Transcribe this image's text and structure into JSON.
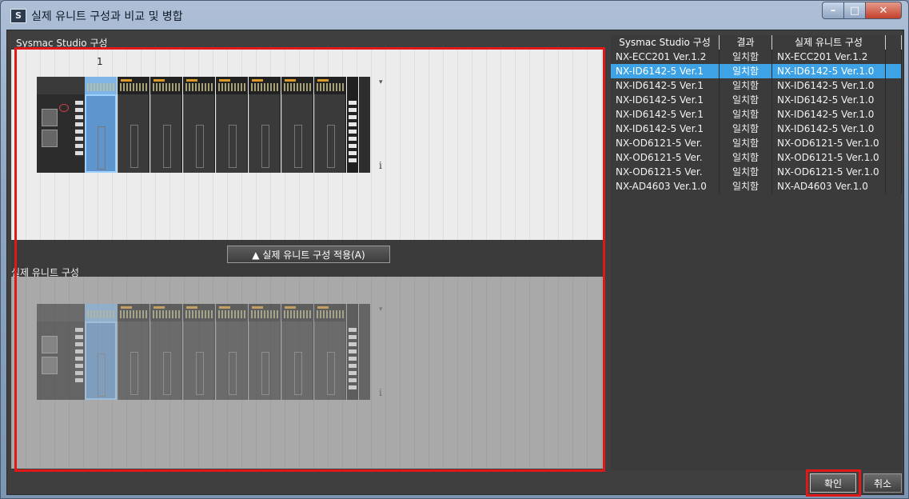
{
  "window": {
    "title": "실제 유니트 구성과 비교 및 병합",
    "app_icon": "S",
    "icons": [
      "app-icon",
      "minimize-icon",
      "maximize-icon",
      "close-icon"
    ]
  },
  "top_section": {
    "label": "Sysmac Studio 구성",
    "unit_number": "1"
  },
  "apply_button": {
    "label": "▲ 실제 유니트 구성 적용(A)"
  },
  "bottom_section": {
    "label": "실제 유니트 구성"
  },
  "rack": {
    "arrow": "▾",
    "info": "i"
  },
  "table": {
    "columns": [
      "Sysmac Studio 구성",
      "결과",
      "실제 유니트 구성"
    ],
    "rows": [
      [
        "NX-ECC201 Ver.1.2",
        "일치함",
        "NX-ECC201 Ver.1.2"
      ],
      [
        "NX-ID6142-5 Ver.1",
        "일치함",
        "NX-ID6142-5 Ver.1.0"
      ],
      [
        "NX-ID6142-5 Ver.1",
        "일치함",
        "NX-ID6142-5 Ver.1.0"
      ],
      [
        "NX-ID6142-5 Ver.1",
        "일치함",
        "NX-ID6142-5 Ver.1.0"
      ],
      [
        "NX-ID6142-5 Ver.1",
        "일치함",
        "NX-ID6142-5 Ver.1.0"
      ],
      [
        "NX-ID6142-5 Ver.1",
        "일치함",
        "NX-ID6142-5 Ver.1.0"
      ],
      [
        "NX-OD6121-5 Ver.",
        "일치함",
        "NX-OD6121-5 Ver.1.0"
      ],
      [
        "NX-OD6121-5 Ver.",
        "일치함",
        "NX-OD6121-5 Ver.1.0"
      ],
      [
        "NX-OD6121-5 Ver.",
        "일치함",
        "NX-OD6121-5 Ver.1.0"
      ],
      [
        "NX-AD4603 Ver.1.0",
        "일치함",
        "NX-AD4603 Ver.1.0"
      ]
    ],
    "selected_row": 1
  },
  "buttons": {
    "ok": "확인",
    "cancel": "취소"
  },
  "colors": {
    "selection": "#3da3e6",
    "highlight_frame": "#e01818"
  }
}
